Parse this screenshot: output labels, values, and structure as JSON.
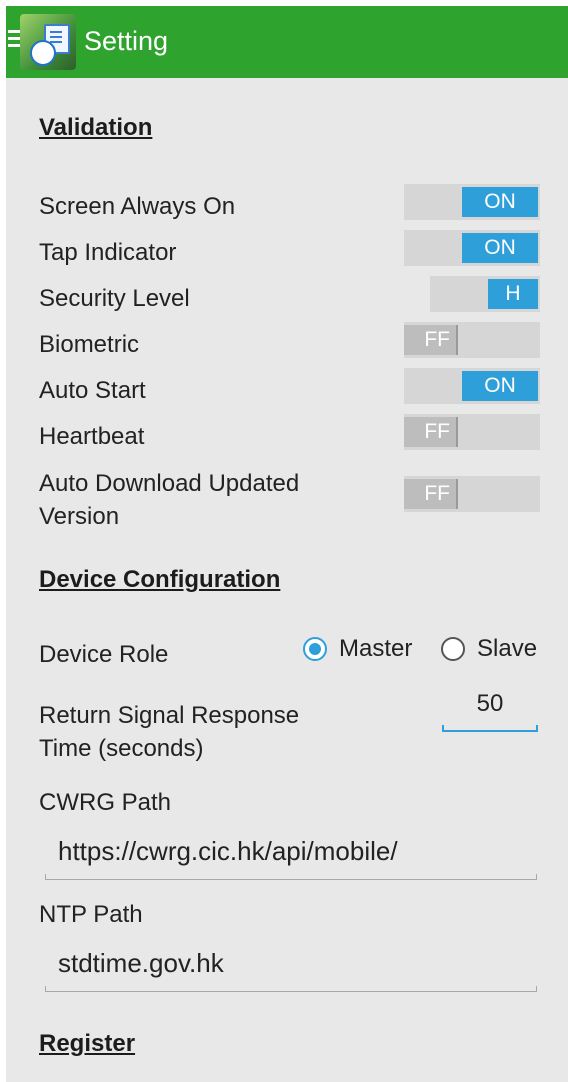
{
  "appbar": {
    "title": "Setting",
    "color": "#2ea32e"
  },
  "sections": {
    "validation": "Validation",
    "device_configuration": "Device Configuration",
    "register": "Register"
  },
  "validation_rows": [
    {
      "label": "Screen Always On",
      "state": "ON"
    },
    {
      "label": "Tap Indicator",
      "state": "ON"
    },
    {
      "label": "Security Level",
      "state": "H"
    },
    {
      "label": "Biometric",
      "state": "OFF"
    },
    {
      "label": "Auto Start",
      "state": "ON"
    },
    {
      "label": "Heartbeat",
      "state": "OFF"
    },
    {
      "label": "Auto Download Updated Version",
      "state": "OFF"
    }
  ],
  "toggle_off_visible_text": "FF",
  "device_role": {
    "label": "Device Role",
    "options": [
      "Master",
      "Slave"
    ],
    "selected": "Master"
  },
  "return_signal": {
    "label_line1": "Return Signal Response",
    "label_line2": "Time (seconds)",
    "value": "50"
  },
  "cwrg": {
    "label": "CWRG Path",
    "value": "https://cwrg.cic.hk/api/mobile/"
  },
  "ntp": {
    "label": "NTP Path",
    "value": "stdtime.gov.hk"
  },
  "colors": {
    "accent": "#2e9fd8",
    "background": "#e8e8e8"
  }
}
